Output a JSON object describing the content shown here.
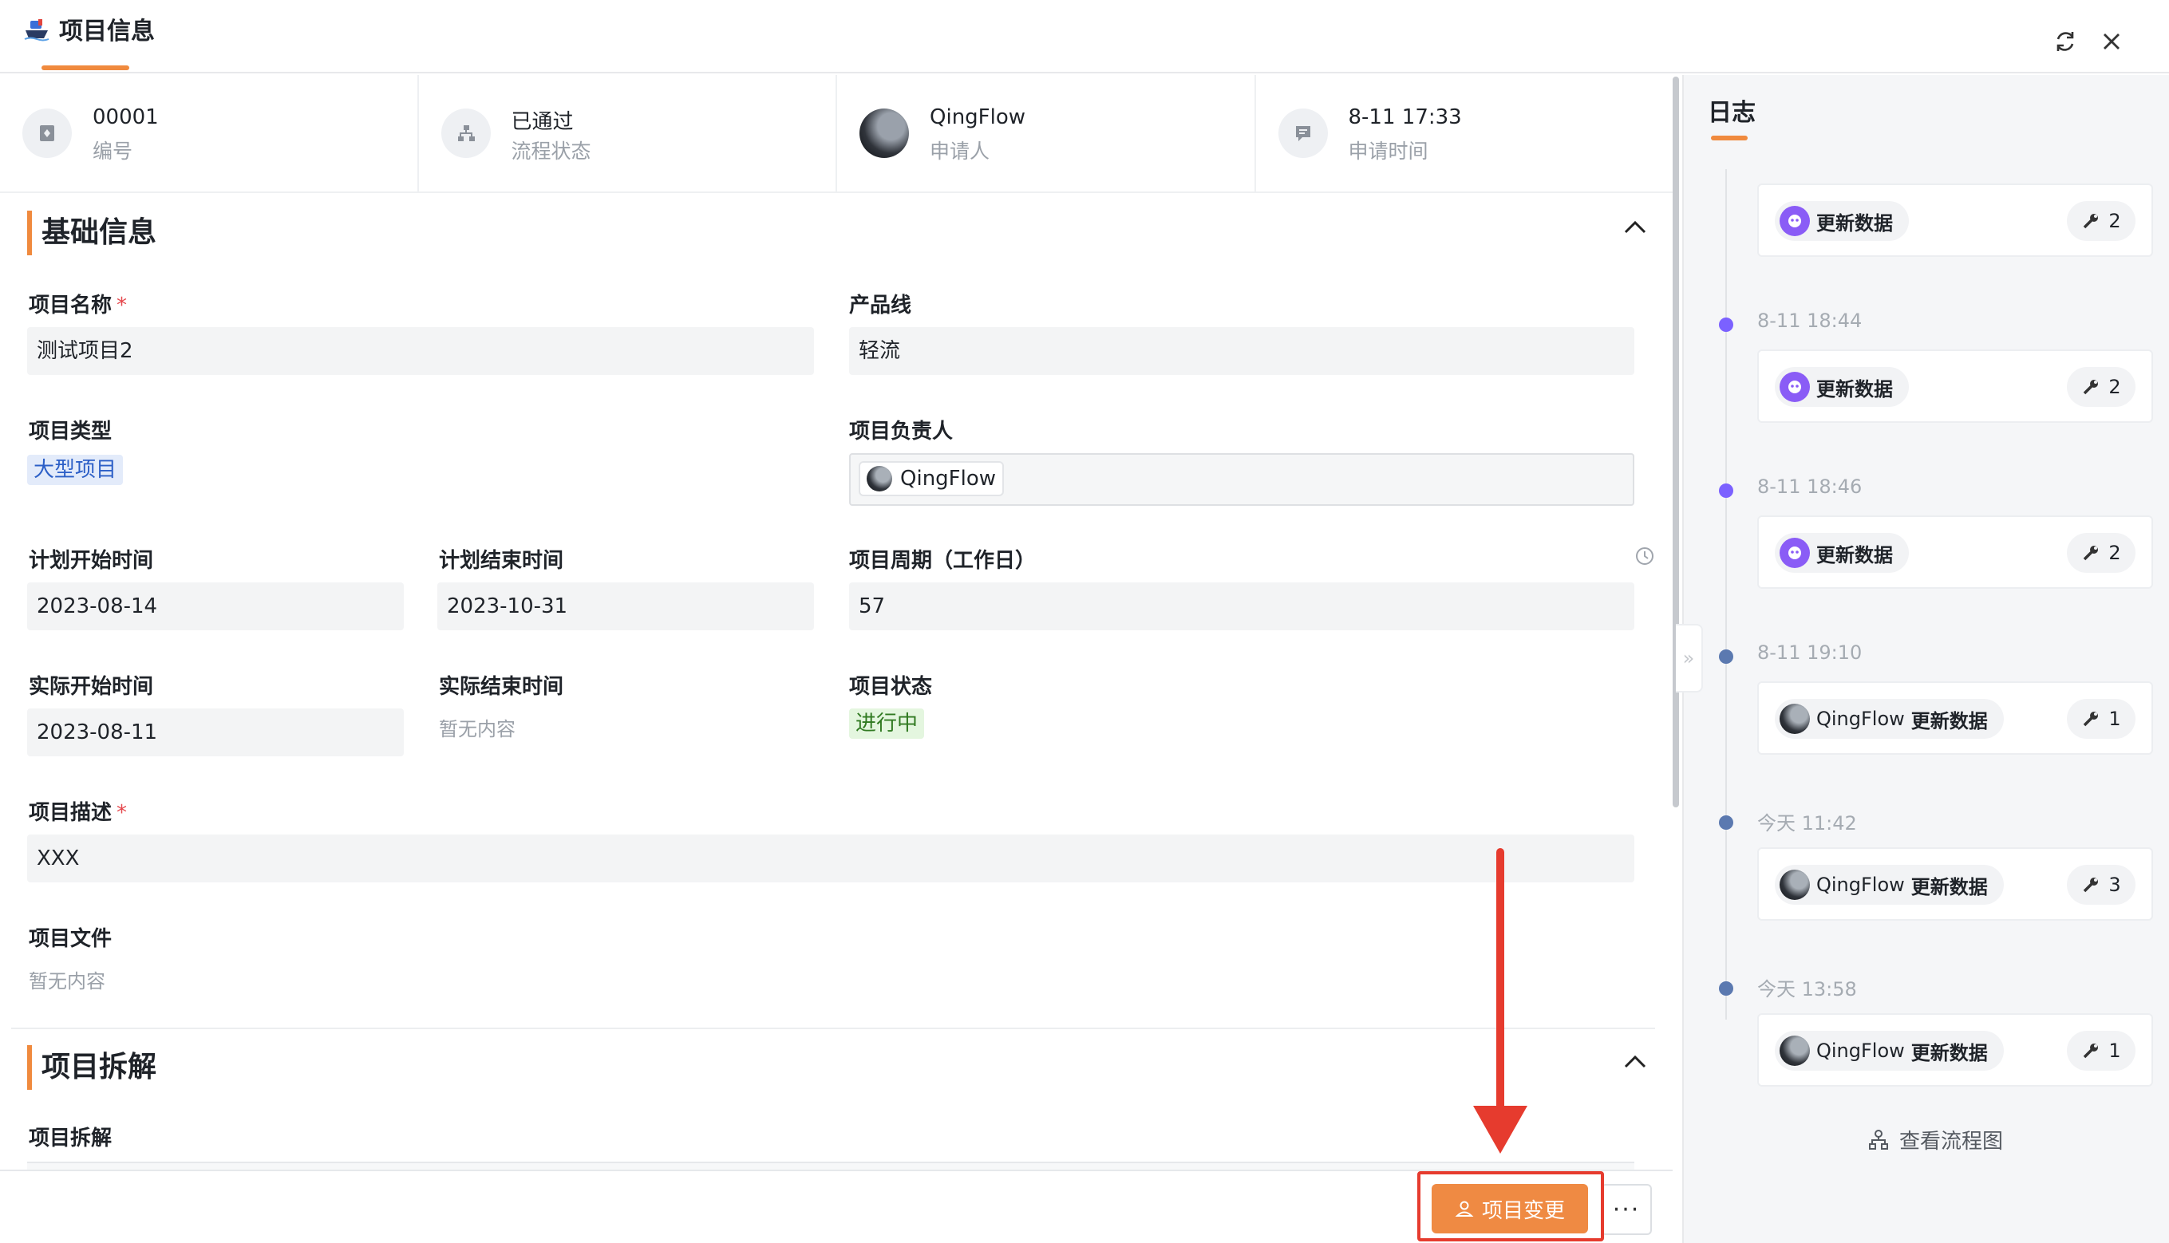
{
  "header": {
    "tab_title": "项目信息",
    "refresh_label": "refresh-icon",
    "close_label": "close-icon"
  },
  "infobar": [
    {
      "value": "00001",
      "label": "编号",
      "icon": "id-icon"
    },
    {
      "value": "已通过",
      "label": "流程状态",
      "icon": "flow-icon"
    },
    {
      "value": "QingFlow",
      "label": "申请人",
      "icon": "avatar"
    },
    {
      "value": "8-11 17:33",
      "label": "申请时间",
      "icon": "message-icon"
    }
  ],
  "basic": {
    "title": "基础信息",
    "fields": {
      "name_label": "项目名称",
      "name_required": "*",
      "name_value": "测试项目2",
      "line_label": "产品线",
      "line_value": "轻流",
      "type_label": "项目类型",
      "type_value": "大型项目",
      "owner_label": "项目负责人",
      "owner_value": "QingFlow",
      "plan_start_label": "计划开始时间",
      "plan_start_value": "2023-08-14",
      "plan_end_label": "计划结束时间",
      "plan_end_value": "2023-10-31",
      "cycle_label": "项目周期（工作日）",
      "cycle_value": "57",
      "actual_start_label": "实际开始时间",
      "actual_start_value": "2023-08-11",
      "actual_end_label": "实际结束时间",
      "actual_end_value": "暂无内容",
      "status_label": "项目状态",
      "status_value": "进行中",
      "desc_label": "项目描述",
      "desc_required": "*",
      "desc_value": "XXX",
      "file_label": "项目文件",
      "file_value": "暂无内容"
    }
  },
  "breakdown": {
    "title": "项目拆解",
    "field_label": "项目拆解"
  },
  "footer": {
    "primary_label": "项目变更",
    "more_label": "···"
  },
  "log": {
    "title": "日志",
    "entries": [
      {
        "time": "",
        "actor": "",
        "action": "更新数据",
        "count": "2",
        "dot": "#7b61ff",
        "avatar": "robot"
      },
      {
        "time": "8-11 18:44",
        "actor": "",
        "action": "更新数据",
        "count": "2",
        "dot": "#7b61ff",
        "avatar": "robot"
      },
      {
        "time": "8-11 18:46",
        "actor": "",
        "action": "更新数据",
        "count": "2",
        "dot": "#7b61ff",
        "avatar": "robot"
      },
      {
        "time": "8-11 19:10",
        "actor": "QingFlow",
        "action": "更新数据",
        "count": "1",
        "dot": "#5b79b0",
        "avatar": "user"
      },
      {
        "time": "今天 11:42",
        "actor": "QingFlow",
        "action": "更新数据",
        "count": "3",
        "dot": "#5b79b0",
        "avatar": "user"
      },
      {
        "time": "今天 13:58",
        "actor": "QingFlow",
        "action": "更新数据",
        "count": "1",
        "dot": "#5b79b0",
        "avatar": "user"
      }
    ],
    "flow_link": "查看流程图"
  },
  "colors": {
    "accent": "#f08a3e",
    "highlight": "#e63b2e"
  }
}
